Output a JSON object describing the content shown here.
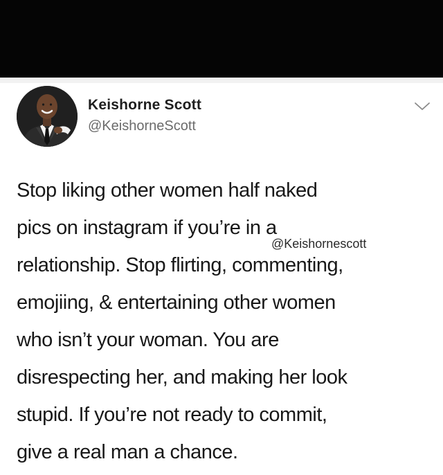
{
  "tweet": {
    "display_name": "Keishorne Scott",
    "handle": "@KeishorneScott",
    "avatar_icon": "user-avatar-photo",
    "menu_icon": "chevron-down-icon",
    "text_lines": [
      "Stop liking other women half naked",
      "pics on instagram if you’re in a",
      "relationship. Stop flirting, commenting,",
      "emojiing, & entertaining other women",
      "who isn’t your woman. You are",
      "disrespecting her, and making her look",
      "stupid. If you’re not ready to commit,",
      "give a real man a chance."
    ]
  },
  "watermark": {
    "text": "@Keishornescott"
  },
  "colors": {
    "top_bar": "#050505",
    "text": "#181818",
    "handle": "#6b6b6b"
  }
}
